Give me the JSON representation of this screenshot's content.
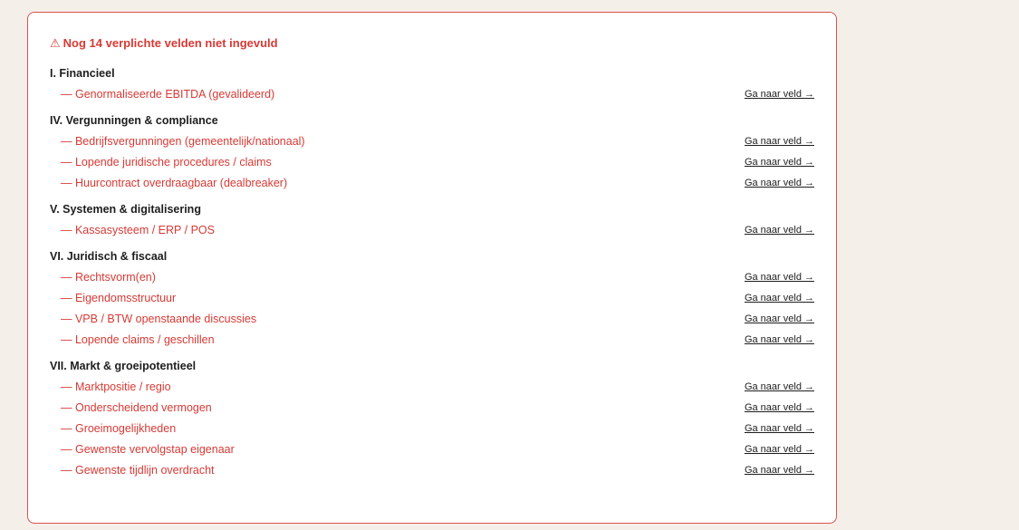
{
  "heading": {
    "icon": "warning-icon",
    "icon_glyph": "⚠",
    "text": "Nog 14 verplichte velden niet ingevuld"
  },
  "link_label": "Ga naar veld →",
  "sections": [
    {
      "title": "I. Financieel",
      "items": [
        "— Genormaliseerde EBITDA (gevalideerd)"
      ]
    },
    {
      "title": "IV. Vergunningen & compliance",
      "items": [
        "— Bedrijfsvergunningen (gemeentelijk/nationaal)",
        "— Lopende juridische procedures / claims",
        "— Huurcontract overdraagbaar (dealbreaker)"
      ]
    },
    {
      "title": "V. Systemen & digitalisering",
      "items": [
        "— Kassasysteem / ERP / POS"
      ]
    },
    {
      "title": "VI. Juridisch & fiscaal",
      "items": [
        "— Rechtsvorm(en)",
        "— Eigendomsstructuur",
        "— VPB / BTW openstaande discussies",
        "— Lopende claims / geschillen"
      ]
    },
    {
      "title": "VII. Markt & groeipotentieel",
      "items": [
        "— Marktpositie / regio",
        "— Onderscheidend vermogen",
        "— Groeimogelijkheden",
        "— Gewenste vervolgstap eigenaar",
        "— Gewenste tijdlijn overdracht"
      ]
    }
  ],
  "colors": {
    "background": "#f4efe8",
    "panel": "#ffffff",
    "accent_red": "#d63a35",
    "border_red": "#d9534f",
    "text_dark": "#1e1e1e"
  }
}
